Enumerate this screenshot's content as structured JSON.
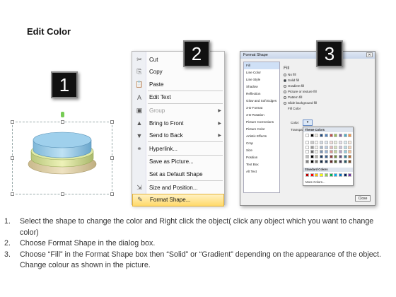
{
  "title": "Edit Color",
  "steps": {
    "s1": "1",
    "s2": "2",
    "s3": "3"
  },
  "context_menu": {
    "items": [
      {
        "label": "Cut",
        "icon": "scissors-icon"
      },
      {
        "label": "Copy",
        "icon": "copy-icon"
      },
      {
        "label": "Paste",
        "icon": "paste-icon"
      },
      {
        "label": "Edit Text",
        "icon": "edit-text-icon"
      },
      {
        "label": "Group",
        "icon": "group-icon",
        "disabled": true,
        "submenu": true
      },
      {
        "label": "Bring to Front",
        "icon": "bring-front-icon",
        "submenu": true
      },
      {
        "label": "Send to Back",
        "icon": "send-back-icon",
        "submenu": true
      },
      {
        "label": "Hyperlink...",
        "icon": "hyperlink-icon"
      },
      {
        "label": "Save as Picture...",
        "icon": ""
      },
      {
        "label": "Set as Default Shape",
        "icon": ""
      },
      {
        "label": "Size and Position...",
        "icon": "size-icon"
      },
      {
        "label": "Format Shape...",
        "icon": "format-shape-icon",
        "highlighted": true
      }
    ]
  },
  "dialog": {
    "title": "Format Shape",
    "close_x": "✕",
    "nav": [
      "Fill",
      "Line Color",
      "Line Style",
      "Shadow",
      "Reflection",
      "Glow and Soft Edges",
      "3-D Format",
      "3-D Rotation",
      "Picture Corrections",
      "Picture Color",
      "Artistic Effects",
      "Crop",
      "Size",
      "Position",
      "Text Box",
      "Alt Text"
    ],
    "pane_title": "Fill",
    "options": [
      "No fill",
      "Solid fill",
      "Gradient fill",
      "Picture or texture fill",
      "Pattern fill",
      "Slide background fill"
    ],
    "fill_color_label": "Fill Color",
    "color_label": "Color:",
    "transparency_label": "Transpa",
    "theme_colors_label": "Theme Colors",
    "standard_colors_label": "Standard Colors",
    "more_colors_label": "More Colors...",
    "close_label": "Close"
  },
  "instructions": [
    {
      "num": "1.",
      "text": "Select the shape to change the color and Right click the object( click any object which you want to change color)"
    },
    {
      "num": "2.",
      "text": "Choose Format Shape in the dialog box."
    },
    {
      "num": "3.",
      "text": "Choose “Fill” in the Format Shape box then “Solid” or “Gradient” depending on the appearance of the object. Change colour as shown in the picture."
    }
  ],
  "colors": {
    "theme_row": [
      "#ffffff",
      "#000000",
      "#eeece1",
      "#1f497d",
      "#4f81bd",
      "#c0504d",
      "#9bbb59",
      "#8064a2",
      "#4bacc6",
      "#f79646"
    ],
    "standard": [
      "#c00000",
      "#ff0000",
      "#ffc000",
      "#ffff00",
      "#92d050",
      "#00b050",
      "#00b0f0",
      "#0070c0",
      "#002060",
      "#7030a0"
    ]
  }
}
